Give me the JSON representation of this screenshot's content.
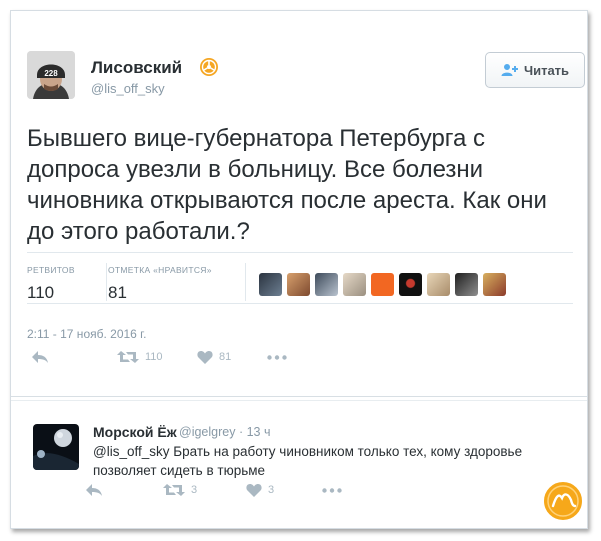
{
  "tweet": {
    "author_name": "Лисовский",
    "handle": "@lis_off_sky",
    "avatar_label": "228",
    "follow_label": "Читать",
    "text": "Бывшего вице-губернатора Петербурга с допроса увезли в больницу. Все болезни чиновника открываются после ареста. Как они до этого работали.?",
    "retweets_label": "РЕТВИТОВ",
    "retweets_count": "110",
    "likes_label": "ОТМЕТКА «НРАВИТСЯ»",
    "likes_count": "81",
    "timestamp": "2:11 - 17 нояб. 2016 г.",
    "actions": {
      "retweet_count": "110",
      "like_count": "81"
    }
  },
  "reply": {
    "author_name": "Морской Ёж",
    "handle": "@igelgrey",
    "time": "13 ч",
    "mention": "@lis_off_sky",
    "text": " Брать на работу чиновником только тех, кому здоровье позволяет сидеть в тюрьме",
    "actions": {
      "retweet_count": "3",
      "like_count": "3"
    }
  },
  "icons": [
    "verified-badge-icon",
    "follow-person-plus-icon",
    "reply-icon",
    "retweet-icon",
    "like-heart-icon",
    "more-dots-icon"
  ],
  "colors": {
    "text": "#292f33",
    "muted": "#8899a6",
    "action_icons": "#aab8c2",
    "follow_icon": "#55acee",
    "verified_badge": "#f5a623"
  }
}
